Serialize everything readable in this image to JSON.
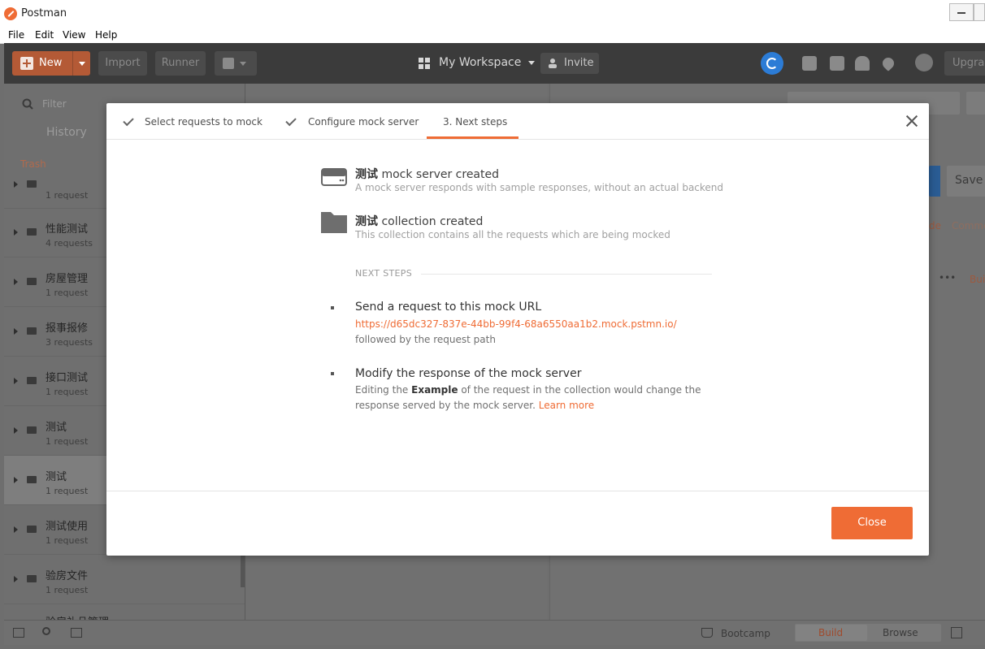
{
  "window": {
    "title": "Postman",
    "ghost_url": "https://www.cnblogs.com/..."
  },
  "menu": [
    "File",
    "Edit",
    "View",
    "Help"
  ],
  "header": {
    "new_label": "New",
    "import_label": "Import",
    "runner_label": "Runner",
    "workspace_label": "My Workspace",
    "invite_label": "Invite",
    "upgrade_label": "Upgra"
  },
  "sidebar": {
    "filter_placeholder": "Filter",
    "history_label": "History",
    "trash_label": "Trash",
    "items": [
      {
        "name": "",
        "count": "1 request"
      },
      {
        "name": "性能测试",
        "count": "4 requests"
      },
      {
        "name": "房屋管理",
        "count": "1 request"
      },
      {
        "name": "报事报修",
        "count": "3 requests"
      },
      {
        "name": "接口测试",
        "count": "1 request"
      },
      {
        "name": "测试",
        "count": "1 request"
      },
      {
        "name": "测试",
        "count": "1 request"
      },
      {
        "name": "测试使用",
        "count": "1 request"
      },
      {
        "name": "验房文件",
        "count": "1 request"
      },
      {
        "name": "验房礼品管理",
        "count": ""
      }
    ]
  },
  "right_panel": {
    "save_label": "Save",
    "code_label": "de",
    "comments_label": "Comme",
    "build_label": "Bui"
  },
  "footer": {
    "bootcamp_label": "Bootcamp",
    "build_label": "Build",
    "browse_label": "Browse"
  },
  "modal": {
    "tabs": [
      {
        "label": "Select requests to mock",
        "done": true
      },
      {
        "label": "Configure mock server",
        "done": true
      },
      {
        "label": "3. Next steps",
        "done": false
      }
    ],
    "server": {
      "name": "测试",
      "title_suffix": " mock server created",
      "desc": "A mock server responds with sample responses, without an actual backend"
    },
    "collection": {
      "name": "测试",
      "title_suffix": " collection created",
      "desc": "This collection contains all the requests which are being mocked"
    },
    "next_steps_label": "NEXT STEPS",
    "step1": {
      "title": "Send a request to this mock URL",
      "url": "https://d65dc327-837e-44bb-99f4-68a6550aa1b2.mock.pstmn.io/",
      "after": " followed by the request path"
    },
    "step2": {
      "title": "Modify the response of the mock server",
      "before": "Editing the ",
      "bold": "Example",
      "after": " of the request in the collection would change the response served by the mock server. ",
      "link": "Learn more"
    },
    "close_label": "Close"
  },
  "colors": {
    "accent": "#ef6c35",
    "sync": "#2c7cd6",
    "header": "#3b3b3b"
  }
}
